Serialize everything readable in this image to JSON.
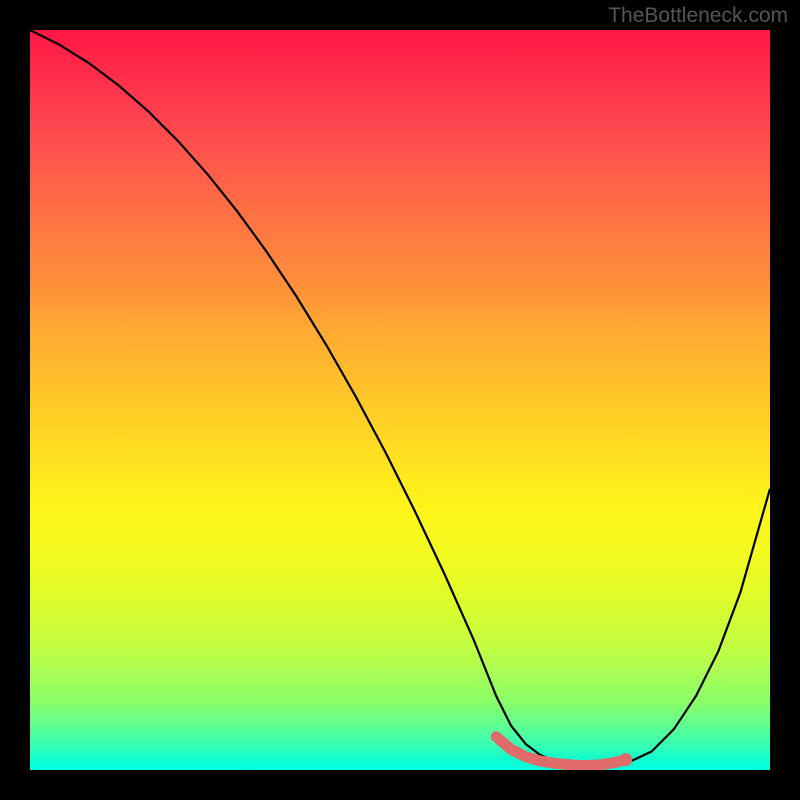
{
  "watermark": "TheBottleneck.com",
  "chart_data": {
    "type": "line",
    "title": "",
    "xlabel": "",
    "ylabel": "",
    "xlim": [
      0,
      100
    ],
    "ylim": [
      0,
      100
    ],
    "gradient_stops": [
      {
        "pos": 0,
        "color": "#ff1744"
      },
      {
        "pos": 50,
        "color": "#ffce26"
      },
      {
        "pos": 75,
        "color": "#e8fb24"
      },
      {
        "pos": 100,
        "color": "#00ffe0"
      }
    ],
    "series": [
      {
        "name": "bottleneck-curve",
        "color": "#000000",
        "x": [
          0,
          4,
          8,
          12,
          16,
          20,
          24,
          28,
          32,
          36,
          40,
          44,
          48,
          52,
          56,
          60,
          63,
          65,
          67,
          69,
          71,
          73,
          75,
          77,
          79,
          81,
          84,
          87,
          90,
          93,
          96,
          100
        ],
        "values": [
          100,
          98,
          95.5,
          92.5,
          89,
          85,
          80.5,
          75.5,
          70,
          64,
          57.5,
          50.5,
          43,
          35,
          26.5,
          17.5,
          10,
          6,
          3.5,
          2,
          1.2,
          0.8,
          0.5,
          0.5,
          0.7,
          1.1,
          2.5,
          5.5,
          10,
          16,
          24,
          38
        ]
      }
    ],
    "marker": {
      "name": "highlight-segment",
      "color": "#e57373",
      "x": [
        63,
        65,
        67,
        69,
        71,
        73,
        75,
        77,
        79,
        80.5
      ],
      "values": [
        4.5,
        2.8,
        1.8,
        1.2,
        0.9,
        0.7,
        0.6,
        0.7,
        1.0,
        1.4
      ]
    }
  }
}
